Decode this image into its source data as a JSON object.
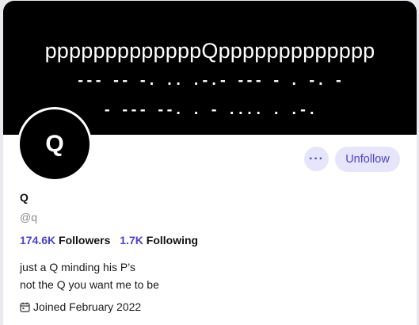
{
  "banner": {
    "title": "pppppppppppppQppppppppppppp",
    "morse_line1": "--- -- -. .. .-.- --- - . -. -",
    "morse_line2": "- --- --. . - .... . .-."
  },
  "profile": {
    "avatar_letter": "Q",
    "name": "Q",
    "handle": "@q",
    "followers_count": "174.6K",
    "followers_label": "Followers",
    "following_count": "1.7K",
    "following_label": "Following",
    "bio_line1": "just a Q minding his P’s",
    "bio_line2": "not the Q you want me to be",
    "joined": "Joined February 2022"
  },
  "actions": {
    "more_label": "···",
    "unfollow_label": "Unfollow"
  },
  "colors": {
    "accent": "#4b43c9",
    "button_bg": "#e6e5fb",
    "banner_bg": "#000000"
  },
  "icons": {
    "joined": "calendar-icon",
    "more": "more-dots-icon"
  }
}
